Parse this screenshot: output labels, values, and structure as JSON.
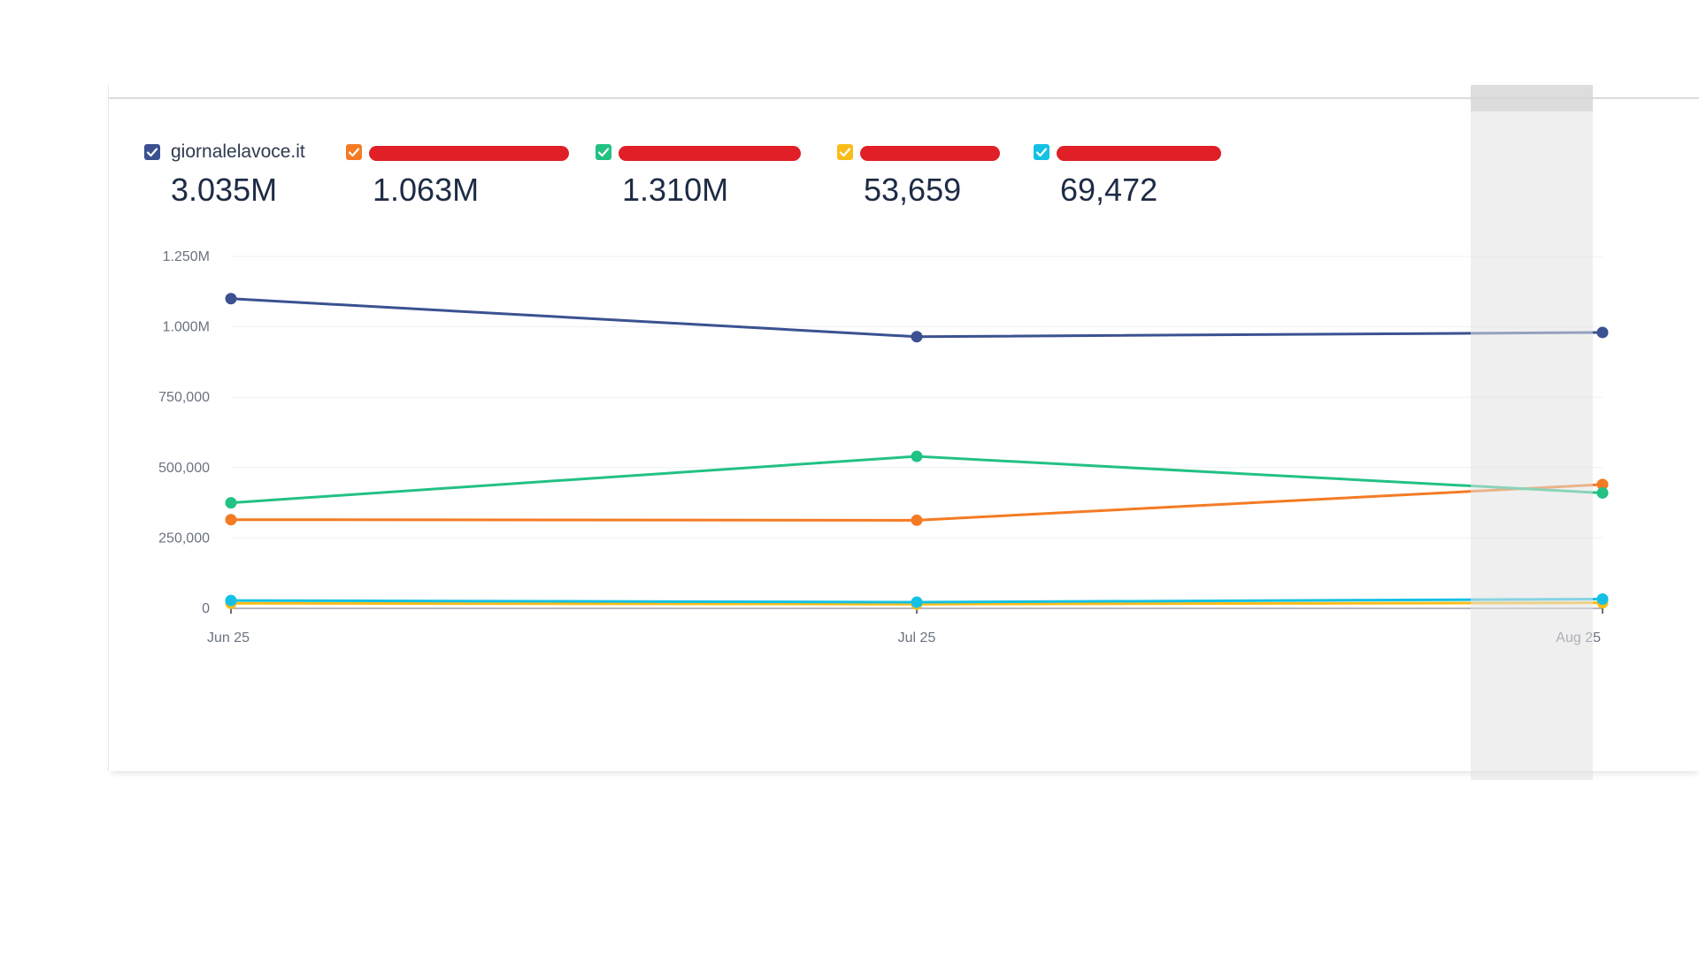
{
  "legend": [
    {
      "label": "giornalelavoce.it",
      "value": "3.035M",
      "color": "#3b5191",
      "redacted": false
    },
    {
      "label": "",
      "value": "1.063M",
      "color": "#f47b24",
      "redacted": true
    },
    {
      "label": "",
      "value": "1.310M",
      "color": "#22c184",
      "redacted": true
    },
    {
      "label": "",
      "value": "53,659",
      "color": "#f9bd19",
      "redacted": true
    },
    {
      "label": "",
      "value": "69,472",
      "color": "#14c1e5",
      "redacted": true
    }
  ],
  "chart_data": {
    "type": "line",
    "x": [
      "Jun 25",
      "Jul 25",
      "Aug 25"
    ],
    "ylim": [
      0,
      1250000
    ],
    "yticks": [
      0,
      250000,
      500000,
      750000,
      1000000,
      1250000
    ],
    "ytick_labels": [
      "0",
      "250,000",
      "500,000",
      "750,000",
      "1.000M",
      "1.250M"
    ],
    "grid": true,
    "series": [
      {
        "name": "giornalelavoce.it",
        "color": "#3b5191",
        "values": [
          1100000,
          965000,
          980000
        ]
      },
      {
        "color": "#f47b24",
        "values": [
          315000,
          313000,
          440000
        ]
      },
      {
        "color": "#22c184",
        "values": [
          375000,
          540000,
          410000
        ]
      },
      {
        "color": "#f9bd19",
        "values": [
          18000,
          15000,
          20000
        ]
      },
      {
        "color": "#14c1e5",
        "values": [
          28000,
          22000,
          33000
        ]
      }
    ]
  }
}
